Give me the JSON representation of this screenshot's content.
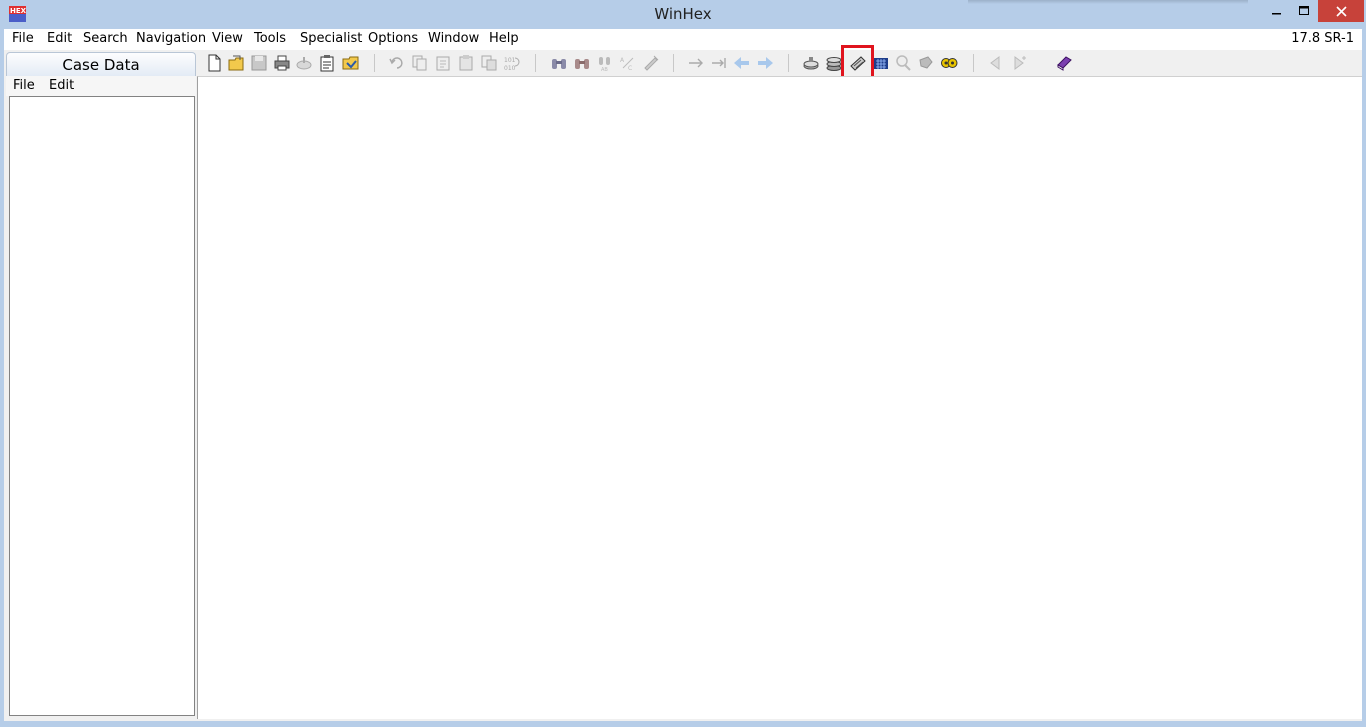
{
  "window": {
    "title": "WinHex",
    "version": "17.8 SR-1"
  },
  "menu": {
    "items": [
      "File",
      "Edit",
      "Search",
      "Navigation",
      "View",
      "Tools",
      "Specialist",
      "Options",
      "Window",
      "Help"
    ]
  },
  "case_panel": {
    "title": "Case Data",
    "menu": [
      "File",
      "Edit"
    ]
  },
  "toolbar": {
    "groups": [
      [
        "new-file-icon",
        "open-file-icon",
        "save-icon",
        "print-icon",
        "export-icon",
        "properties-icon",
        "open-folder-icon"
      ],
      [
        "undo-icon",
        "copy-icon",
        "cut-icon",
        "paste-icon",
        "paste-special-icon",
        "convert-icon"
      ],
      [
        "find-text-icon",
        "find-hex-icon",
        "replace-text-icon",
        "replace-hex-icon",
        "find-again-icon"
      ],
      [
        "goto-offset-icon",
        "goto-sector-icon",
        "back-icon",
        "forward-icon"
      ],
      [
        "open-disk-icon",
        "clone-disk-icon",
        "open-ram-icon",
        "calculator-icon",
        "hash-icon",
        "analyze-icon",
        "tools-icon"
      ],
      [
        "previous-icon",
        "next-icon"
      ],
      [
        "help-book-icon"
      ]
    ],
    "highlighted": "open-ram-icon"
  },
  "colors": {
    "titlebar": "#b6cde8",
    "close_button": "#c7423a",
    "highlight": "#e0141e"
  }
}
